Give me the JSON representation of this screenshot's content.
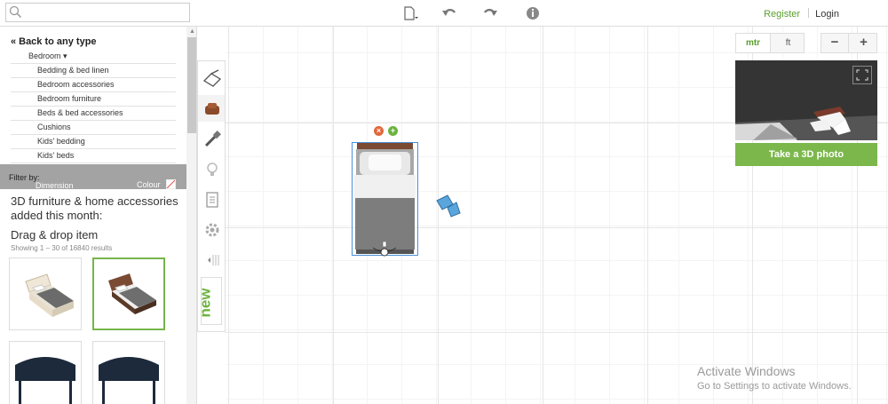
{
  "search": {
    "placeholder": ""
  },
  "toolbar": {
    "icons": [
      "new-document-icon",
      "undo-icon",
      "redo-icon",
      "info-icon"
    ]
  },
  "auth": {
    "register": "Register",
    "login": "Login"
  },
  "sidebar": {
    "back_label": "Back to any type",
    "back_glyph": "«",
    "category": "Bedroom ▾",
    "subcategories": [
      "Bedding & bed linen",
      "Bedroom accessories",
      "Bedroom furniture",
      "Beds & bed accessories",
      "Cushions",
      "Kids' bedding",
      "Kids' beds"
    ],
    "filter_label": "Filter by:",
    "filter_dimension": "Dimension",
    "filter_colour": "Colour",
    "heading": "3D furniture & home accessories added this month:",
    "drag_label": "Drag & drop item",
    "results": "Showing 1 – 30 of 16840 results"
  },
  "tools": [
    "floor-plan-tool-icon",
    "furniture-tool-icon",
    "paint-tool-icon",
    "light-tool-icon",
    "list-tool-icon",
    "settings-tool-icon",
    "collapse-tool-icon"
  ],
  "new_tab": "new",
  "units": {
    "metric": "mtr",
    "imperial": "ft",
    "active": "mtr"
  },
  "zoom": {
    "out": "−",
    "in": "+"
  },
  "preview": {
    "button": "Take a 3D photo"
  },
  "canvas_buttons": {
    "delete": "×",
    "add": "+"
  },
  "watermark": {
    "title": "Activate Windows",
    "subtitle": "Go to Settings to activate Windows."
  },
  "colors": {
    "accent": "#6cb33f",
    "photo_button": "#7cb74c",
    "selection": "#4a90d9",
    "delete": "#e2673b",
    "filter_bar": "#a3a3a3"
  }
}
